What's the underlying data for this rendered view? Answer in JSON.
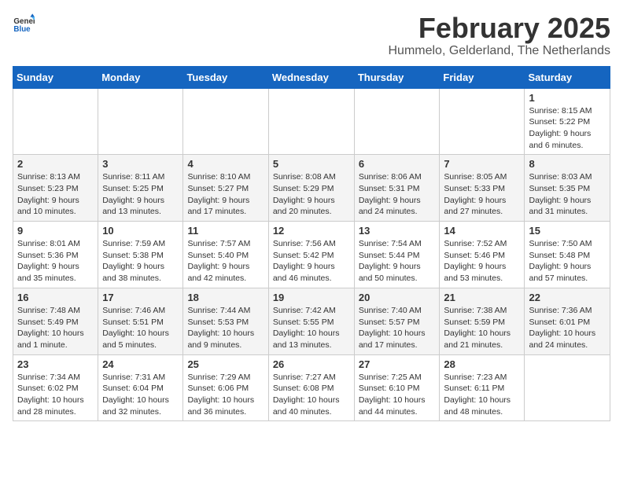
{
  "header": {
    "logo_general": "General",
    "logo_blue": "Blue",
    "month": "February 2025",
    "location": "Hummelo, Gelderland, The Netherlands"
  },
  "weekdays": [
    "Sunday",
    "Monday",
    "Tuesday",
    "Wednesday",
    "Thursday",
    "Friday",
    "Saturday"
  ],
  "weeks": [
    [
      {
        "day": "",
        "info": ""
      },
      {
        "day": "",
        "info": ""
      },
      {
        "day": "",
        "info": ""
      },
      {
        "day": "",
        "info": ""
      },
      {
        "day": "",
        "info": ""
      },
      {
        "day": "",
        "info": ""
      },
      {
        "day": "1",
        "info": "Sunrise: 8:15 AM\nSunset: 5:22 PM\nDaylight: 9 hours and 6 minutes."
      }
    ],
    [
      {
        "day": "2",
        "info": "Sunrise: 8:13 AM\nSunset: 5:23 PM\nDaylight: 9 hours and 10 minutes."
      },
      {
        "day": "3",
        "info": "Sunrise: 8:11 AM\nSunset: 5:25 PM\nDaylight: 9 hours and 13 minutes."
      },
      {
        "day": "4",
        "info": "Sunrise: 8:10 AM\nSunset: 5:27 PM\nDaylight: 9 hours and 17 minutes."
      },
      {
        "day": "5",
        "info": "Sunrise: 8:08 AM\nSunset: 5:29 PM\nDaylight: 9 hours and 20 minutes."
      },
      {
        "day": "6",
        "info": "Sunrise: 8:06 AM\nSunset: 5:31 PM\nDaylight: 9 hours and 24 minutes."
      },
      {
        "day": "7",
        "info": "Sunrise: 8:05 AM\nSunset: 5:33 PM\nDaylight: 9 hours and 27 minutes."
      },
      {
        "day": "8",
        "info": "Sunrise: 8:03 AM\nSunset: 5:35 PM\nDaylight: 9 hours and 31 minutes."
      }
    ],
    [
      {
        "day": "9",
        "info": "Sunrise: 8:01 AM\nSunset: 5:36 PM\nDaylight: 9 hours and 35 minutes."
      },
      {
        "day": "10",
        "info": "Sunrise: 7:59 AM\nSunset: 5:38 PM\nDaylight: 9 hours and 38 minutes."
      },
      {
        "day": "11",
        "info": "Sunrise: 7:57 AM\nSunset: 5:40 PM\nDaylight: 9 hours and 42 minutes."
      },
      {
        "day": "12",
        "info": "Sunrise: 7:56 AM\nSunset: 5:42 PM\nDaylight: 9 hours and 46 minutes."
      },
      {
        "day": "13",
        "info": "Sunrise: 7:54 AM\nSunset: 5:44 PM\nDaylight: 9 hours and 50 minutes."
      },
      {
        "day": "14",
        "info": "Sunrise: 7:52 AM\nSunset: 5:46 PM\nDaylight: 9 hours and 53 minutes."
      },
      {
        "day": "15",
        "info": "Sunrise: 7:50 AM\nSunset: 5:48 PM\nDaylight: 9 hours and 57 minutes."
      }
    ],
    [
      {
        "day": "16",
        "info": "Sunrise: 7:48 AM\nSunset: 5:49 PM\nDaylight: 10 hours and 1 minute."
      },
      {
        "day": "17",
        "info": "Sunrise: 7:46 AM\nSunset: 5:51 PM\nDaylight: 10 hours and 5 minutes."
      },
      {
        "day": "18",
        "info": "Sunrise: 7:44 AM\nSunset: 5:53 PM\nDaylight: 10 hours and 9 minutes."
      },
      {
        "day": "19",
        "info": "Sunrise: 7:42 AM\nSunset: 5:55 PM\nDaylight: 10 hours and 13 minutes."
      },
      {
        "day": "20",
        "info": "Sunrise: 7:40 AM\nSunset: 5:57 PM\nDaylight: 10 hours and 17 minutes."
      },
      {
        "day": "21",
        "info": "Sunrise: 7:38 AM\nSunset: 5:59 PM\nDaylight: 10 hours and 21 minutes."
      },
      {
        "day": "22",
        "info": "Sunrise: 7:36 AM\nSunset: 6:01 PM\nDaylight: 10 hours and 24 minutes."
      }
    ],
    [
      {
        "day": "23",
        "info": "Sunrise: 7:34 AM\nSunset: 6:02 PM\nDaylight: 10 hours and 28 minutes."
      },
      {
        "day": "24",
        "info": "Sunrise: 7:31 AM\nSunset: 6:04 PM\nDaylight: 10 hours and 32 minutes."
      },
      {
        "day": "25",
        "info": "Sunrise: 7:29 AM\nSunset: 6:06 PM\nDaylight: 10 hours and 36 minutes."
      },
      {
        "day": "26",
        "info": "Sunrise: 7:27 AM\nSunset: 6:08 PM\nDaylight: 10 hours and 40 minutes."
      },
      {
        "day": "27",
        "info": "Sunrise: 7:25 AM\nSunset: 6:10 PM\nDaylight: 10 hours and 44 minutes."
      },
      {
        "day": "28",
        "info": "Sunrise: 7:23 AM\nSunset: 6:11 PM\nDaylight: 10 hours and 48 minutes."
      },
      {
        "day": "",
        "info": ""
      }
    ]
  ]
}
